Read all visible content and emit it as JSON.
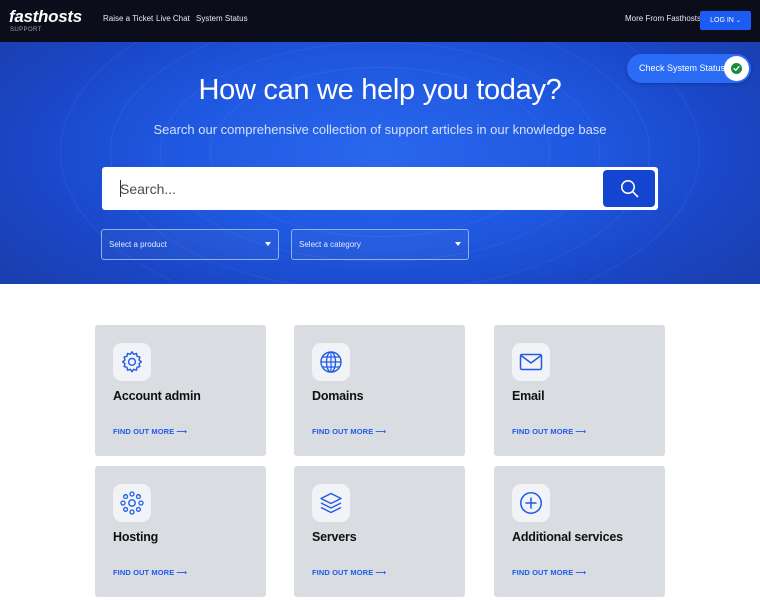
{
  "brand": {
    "logo": "fasthosts",
    "sub": "SUPPORT"
  },
  "nav": {
    "links": [
      "Raise a Ticket",
      "Live Chat",
      "System Status"
    ],
    "more": "More From Fasthosts",
    "login": "LOG IN"
  },
  "hero": {
    "title": "How can we help you today?",
    "subtitle": "Search our comprehensive collection of support articles in our knowledge base",
    "status_button": "Check System Status",
    "search_placeholder": "Search...",
    "product_select": "Select a product",
    "category_select": "Select a category"
  },
  "cards": [
    {
      "title": "Account admin",
      "link": "FIND OUT MORE",
      "icon": "gear-icon"
    },
    {
      "title": "Domains",
      "link": "FIND OUT MORE",
      "icon": "globe-icon"
    },
    {
      "title": "Email",
      "link": "FIND OUT MORE",
      "icon": "envelope-icon"
    },
    {
      "title": "Hosting",
      "link": "FIND OUT MORE",
      "icon": "network-icon"
    },
    {
      "title": "Servers",
      "link": "FIND OUT MORE",
      "icon": "layers-icon"
    },
    {
      "title": "Additional services",
      "link": "FIND OUT MORE",
      "icon": "plus-circle-icon"
    }
  ],
  "colors": {
    "nav_bg": "#0c0d1a",
    "hero_blue": "#1f58e0",
    "accent": "#1d5cf2",
    "search_button": "#1445d0",
    "card_bg": "#d9dce1",
    "link": "#1f5be8",
    "status_ok": "#188a3a"
  }
}
